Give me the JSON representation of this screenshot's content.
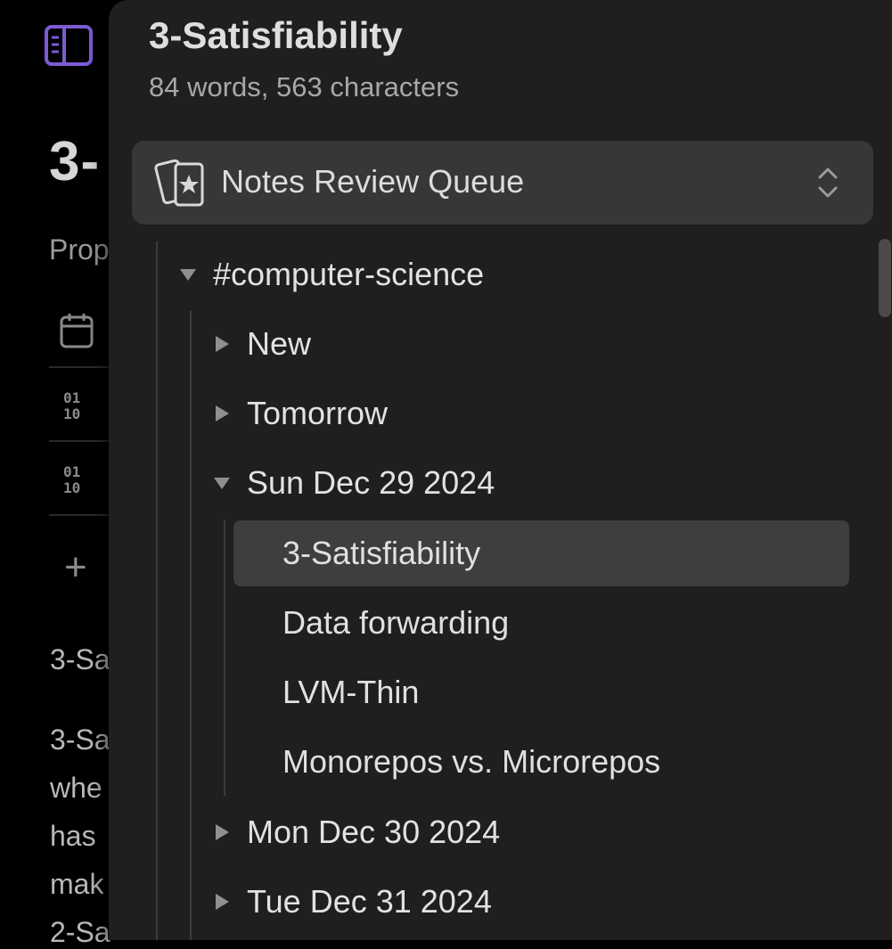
{
  "colors": {
    "accent": "#7c5bd6",
    "panel_bg": "#1f1f1f",
    "active_row_bg": "#3e3e3e"
  },
  "background_editor": {
    "title_partial": "3-",
    "properties_partial": "Prop",
    "body_lines_partial": [
      "3-Sa",
      "3-Sa",
      "whe",
      "has",
      "mak",
      "2-Sa"
    ]
  },
  "panel": {
    "title": "3-Satisfiability",
    "subtitle": "84 words, 563 characters",
    "queue_selector": {
      "label": "Notes Review Queue",
      "icon": "cards-star-icon"
    },
    "tree": {
      "root": {
        "label": "#computer-science",
        "expanded": true
      },
      "groups": [
        {
          "label": "New",
          "expanded": false
        },
        {
          "label": "Tomorrow",
          "expanded": false
        },
        {
          "label": "Sun Dec 29 2024",
          "expanded": true,
          "notes": [
            "3-Satisfiability",
            "Data forwarding",
            "LVM-Thin",
            "Monorepos vs. Microrepos"
          ],
          "active_note": "3-Satisfiability"
        },
        {
          "label": "Mon Dec 30 2024",
          "expanded": false
        },
        {
          "label": "Tue Dec 31 2024",
          "expanded": false
        }
      ]
    }
  }
}
